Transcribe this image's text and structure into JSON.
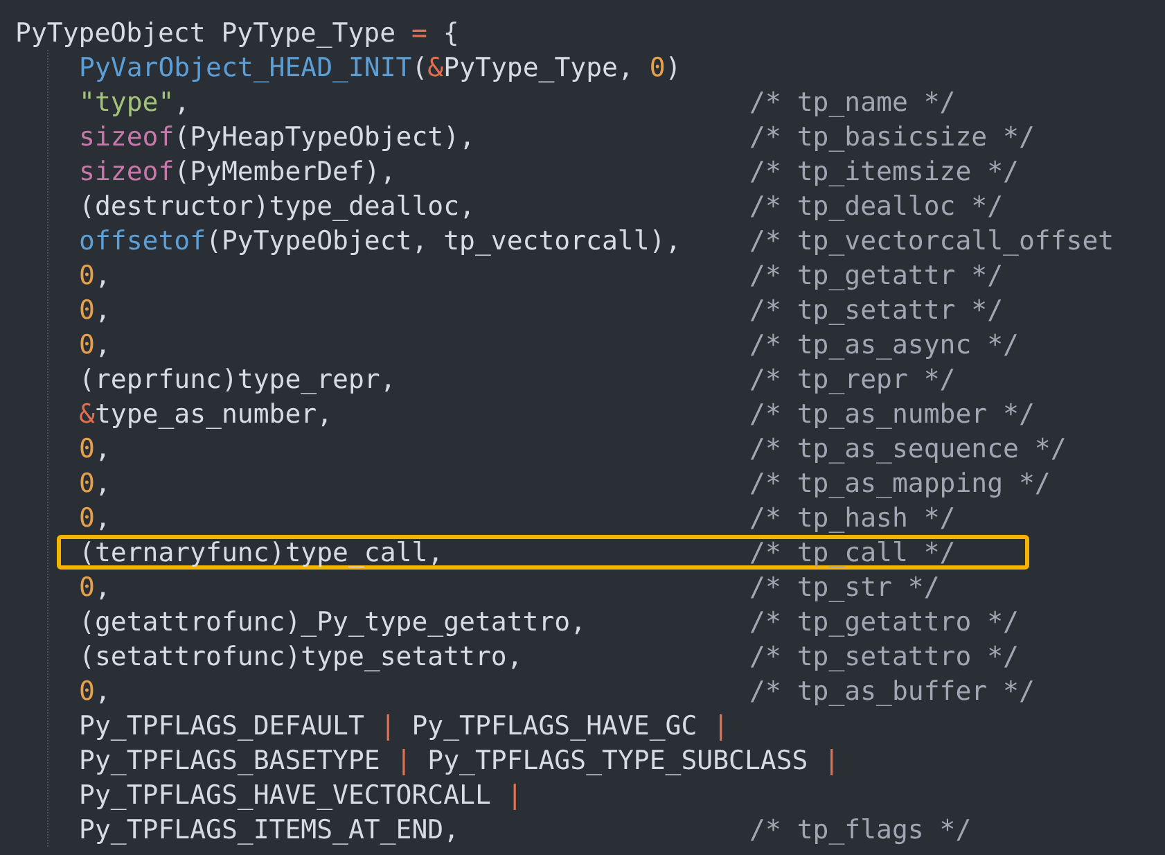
{
  "code": {
    "header": {
      "tokens": [
        {
          "text": "PyTypeObject PyType_Type ",
          "kind": "plain"
        },
        {
          "text": "=",
          "kind": "operator"
        },
        {
          "text": " {",
          "kind": "plain"
        }
      ]
    },
    "lines": [
      {
        "highlighted": false,
        "tokens": [
          {
            "text": "PyVarObject_HEAD_INIT",
            "kind": "macro"
          },
          {
            "text": "(",
            "kind": "plain"
          },
          {
            "text": "&",
            "kind": "operator"
          },
          {
            "text": "PyType_Type, ",
            "kind": "plain"
          },
          {
            "text": "0",
            "kind": "number"
          },
          {
            "text": ")",
            "kind": "plain"
          }
        ]
      },
      {
        "highlighted": false,
        "tokens": [
          {
            "text": "\"type\"",
            "kind": "string"
          },
          {
            "text": ",",
            "kind": "plain"
          }
        ],
        "comment": "/* tp_name */"
      },
      {
        "highlighted": false,
        "tokens": [
          {
            "text": "sizeof",
            "kind": "keyword"
          },
          {
            "text": "(PyHeapTypeObject),",
            "kind": "plain"
          }
        ],
        "comment": "/* tp_basicsize */"
      },
      {
        "highlighted": false,
        "tokens": [
          {
            "text": "sizeof",
            "kind": "keyword"
          },
          {
            "text": "(PyMemberDef),",
            "kind": "plain"
          }
        ],
        "comment": "/* tp_itemsize */"
      },
      {
        "highlighted": false,
        "tokens": [
          {
            "text": "(destructor)type_dealloc,",
            "kind": "plain"
          }
        ],
        "comment": "/* tp_dealloc */"
      },
      {
        "highlighted": false,
        "tokens": [
          {
            "text": "offsetof",
            "kind": "macro"
          },
          {
            "text": "(PyTypeObject, tp_vectorcall),",
            "kind": "plain"
          }
        ],
        "comment": "/* tp_vectorcall_offset"
      },
      {
        "highlighted": false,
        "tokens": [
          {
            "text": "0",
            "kind": "number"
          },
          {
            "text": ",",
            "kind": "plain"
          }
        ],
        "comment": "/* tp_getattr */"
      },
      {
        "highlighted": false,
        "tokens": [
          {
            "text": "0",
            "kind": "number"
          },
          {
            "text": ",",
            "kind": "plain"
          }
        ],
        "comment": "/* tp_setattr */"
      },
      {
        "highlighted": false,
        "tokens": [
          {
            "text": "0",
            "kind": "number"
          },
          {
            "text": ",",
            "kind": "plain"
          }
        ],
        "comment": "/* tp_as_async */"
      },
      {
        "highlighted": false,
        "tokens": [
          {
            "text": "(reprfunc)type_repr,",
            "kind": "plain"
          }
        ],
        "comment": "/* tp_repr */"
      },
      {
        "highlighted": false,
        "tokens": [
          {
            "text": "&",
            "kind": "operator"
          },
          {
            "text": "type_as_number,",
            "kind": "plain"
          }
        ],
        "comment": "/* tp_as_number */"
      },
      {
        "highlighted": false,
        "tokens": [
          {
            "text": "0",
            "kind": "number"
          },
          {
            "text": ",",
            "kind": "plain"
          }
        ],
        "comment": "/* tp_as_sequence */"
      },
      {
        "highlighted": false,
        "tokens": [
          {
            "text": "0",
            "kind": "number"
          },
          {
            "text": ",",
            "kind": "plain"
          }
        ],
        "comment": "/* tp_as_mapping */"
      },
      {
        "highlighted": false,
        "tokens": [
          {
            "text": "0",
            "kind": "number"
          },
          {
            "text": ",",
            "kind": "plain"
          }
        ],
        "comment": "/* tp_hash */"
      },
      {
        "highlighted": true,
        "tokens": [
          {
            "text": "(ternaryfunc)type_call,",
            "kind": "plain"
          }
        ],
        "comment": "/* tp_call */"
      },
      {
        "highlighted": false,
        "tokens": [
          {
            "text": "0",
            "kind": "number"
          },
          {
            "text": ",",
            "kind": "plain"
          }
        ],
        "comment": "/* tp_str */"
      },
      {
        "highlighted": false,
        "tokens": [
          {
            "text": "(getattrofunc)_Py_type_getattro,",
            "kind": "plain"
          }
        ],
        "comment": "/* tp_getattro */"
      },
      {
        "highlighted": false,
        "tokens": [
          {
            "text": "(setattrofunc)type_setattro,",
            "kind": "plain"
          }
        ],
        "comment": "/* tp_setattro */"
      },
      {
        "highlighted": false,
        "tokens": [
          {
            "text": "0",
            "kind": "number"
          },
          {
            "text": ",",
            "kind": "plain"
          }
        ],
        "comment": "/* tp_as_buffer */"
      },
      {
        "highlighted": false,
        "tokens": [
          {
            "text": "Py_TPFLAGS_DEFAULT ",
            "kind": "plain"
          },
          {
            "text": "|",
            "kind": "operator"
          },
          {
            "text": " Py_TPFLAGS_HAVE_GC ",
            "kind": "plain"
          },
          {
            "text": "|",
            "kind": "operator"
          }
        ]
      },
      {
        "highlighted": false,
        "tokens": [
          {
            "text": "Py_TPFLAGS_BASETYPE ",
            "kind": "plain"
          },
          {
            "text": "|",
            "kind": "operator"
          },
          {
            "text": " Py_TPFLAGS_TYPE_SUBCLASS ",
            "kind": "plain"
          },
          {
            "text": "|",
            "kind": "operator"
          }
        ]
      },
      {
        "highlighted": false,
        "tokens": [
          {
            "text": "Py_TPFLAGS_HAVE_VECTORCALL ",
            "kind": "plain"
          },
          {
            "text": "|",
            "kind": "operator"
          }
        ]
      },
      {
        "highlighted": false,
        "tokens": [
          {
            "text": "Py_TPFLAGS_ITEMS_AT_END,",
            "kind": "plain"
          }
        ],
        "comment": "/* tp_flags */"
      }
    ]
  }
}
